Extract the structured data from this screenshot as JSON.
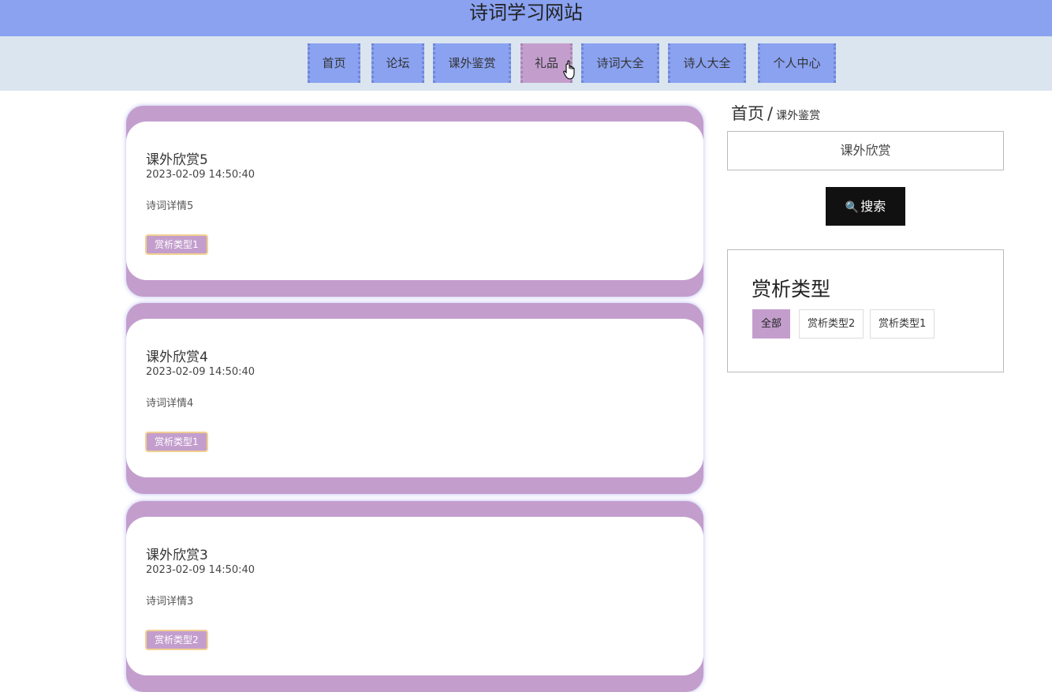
{
  "header": {
    "site_title": "诗词学习网站"
  },
  "nav": {
    "items": [
      {
        "label": "首页"
      },
      {
        "label": "论坛"
      },
      {
        "label": "课外鉴赏"
      },
      {
        "label": "礼品"
      },
      {
        "label": "诗词大全"
      },
      {
        "label": "诗人大全"
      },
      {
        "label": "个人中心"
      }
    ],
    "active_label": "礼品"
  },
  "posts": [
    {
      "title": "课外欣赏5",
      "date": "2023-02-09 14:50:40",
      "desc": "诗词详情5",
      "tag": "赏析类型1"
    },
    {
      "title": "课外欣赏4",
      "date": "2023-02-09 14:50:40",
      "desc": "诗词详情4",
      "tag": "赏析类型1"
    },
    {
      "title": "课外欣赏3",
      "date": "2023-02-09 14:50:40",
      "desc": "诗词详情3",
      "tag": "赏析类型2"
    }
  ],
  "sidebar": {
    "breadcrumb": {
      "home": "首页",
      "sep": "/",
      "current": "课外鉴赏"
    },
    "search": {
      "value": "课外欣赏",
      "button_icon": "🔍",
      "button_label": "搜索"
    },
    "categories": {
      "title": "赏析类型",
      "items": [
        {
          "label": "全部"
        },
        {
          "label": "赏析类型2"
        },
        {
          "label": "赏析类型1"
        }
      ],
      "active": "全部"
    }
  },
  "colors": {
    "header": "#8aa2f0",
    "nav_bg": "#dbe5ef",
    "accent": "#c39ecd",
    "button_dark": "#111111"
  }
}
